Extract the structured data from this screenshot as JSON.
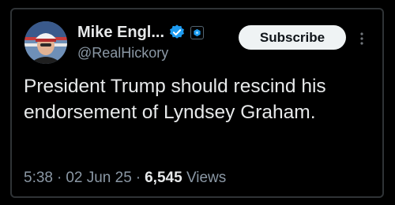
{
  "author": {
    "display_name": "Mike Engl...",
    "handle": "@RealHickory",
    "avatar_icon": "profile-avatar",
    "verified_icon": "verified-badge-icon",
    "verified_color": "#1d9bf0",
    "affiliation_icon": "affiliate-badge-icon",
    "affiliation_color": "#1d9bf0"
  },
  "actions": {
    "subscribe_label": "Subscribe",
    "more_icon": "more-options-icon"
  },
  "tweet": {
    "text": "President Trump should rescind his endorsement of Lyndsey Graham."
  },
  "meta": {
    "time": "5:38",
    "separator": "·",
    "date": "02 Jun 25",
    "views_count": "6,545",
    "views_label": "Views"
  },
  "colors": {
    "background": "#000000",
    "text_primary": "#e7e9ea",
    "text_secondary": "#8b98a5",
    "button_bg": "#eff3f4"
  }
}
